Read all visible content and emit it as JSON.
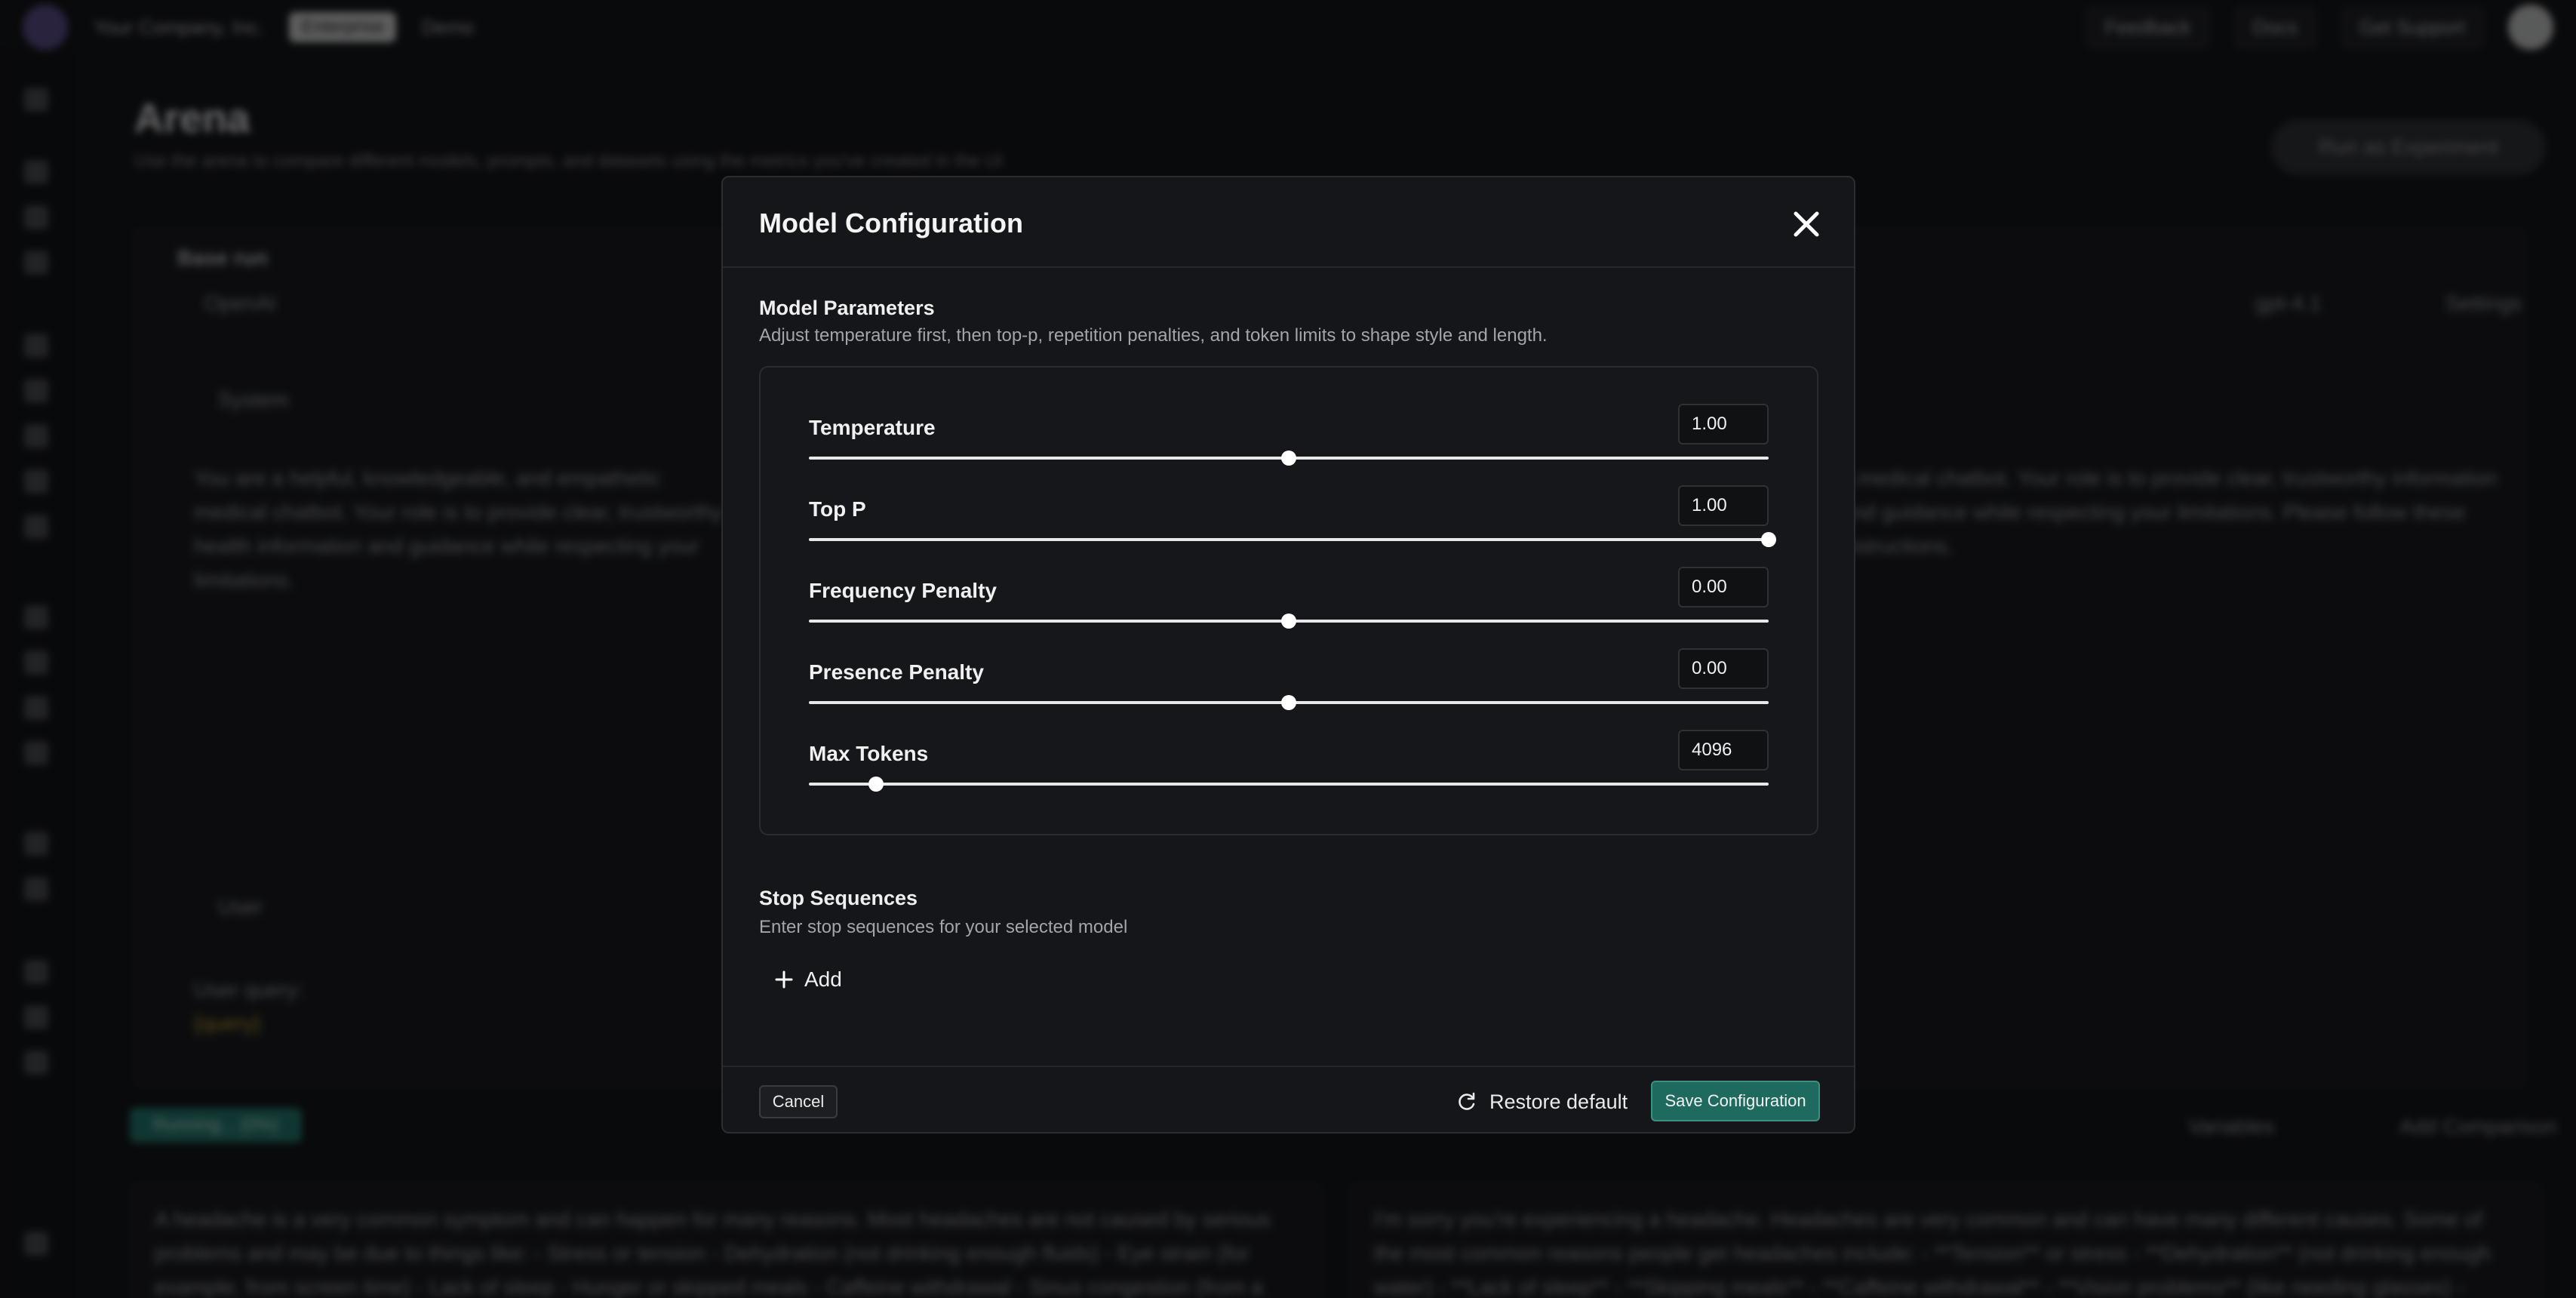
{
  "background": {
    "topbar": {
      "org": "Your Company, Inc.",
      "plan_chip": "Enterprise",
      "project": "Demo",
      "feedback": "Feedback",
      "docs": "Docs",
      "support": "Get Support"
    },
    "page": {
      "title": "Arena",
      "subtitle": "Use the arena to compare different models, prompts, and datasets using the metrics you've created in the UI",
      "run_experiment": "Run as Experiment"
    },
    "left_panel": {
      "base_run": "Base run",
      "provider": "OpenAI",
      "system_label": "System",
      "system_text": "You are a helpful, knowledgeable, and empathetic medical chatbot. Your role is to provide clear, trustworthy health information and guidance while respecting your limitations.",
      "user_label": "User",
      "user_text": "User query:",
      "user_var": "{query}"
    },
    "right_panel": {
      "model": "gpt-4.1",
      "settings": "Settings",
      "text": "...medical chatbot. Your role is to provide clear, trustworthy information and guidance while respecting your limitations. Please follow these instructions."
    },
    "running_label": "Running... (0%)",
    "variables": "Variables",
    "add_comparison": "Add Comparison",
    "output_left": "A headache is a very common symptom and can happen for many reasons. Most headaches are not caused by serious problems and may be due to things like: - Stress or tension - Dehydration (not drinking enough fluids) - Eye strain (for example, from screen time) - Lack of sleep - Hunger or skipped meals - Caffeine withdrawal - Sinus congestion (from a cold or allergies) - Certain",
    "output_right": "I'm sorry you're experiencing a headache. Headaches are very common and can have many different causes. Some of the most common reasons people get headaches include: - **Tension** or stress - **Dehydration** (not drinking enough water) - **Lack of sleep** - **Skipping meals** - **Caffeine withdrawal** - **Vision problems** (like needing glasses) - **Sinus issues** or allergies -"
  },
  "modal": {
    "title": "Model Configuration",
    "params_title": "Model Parameters",
    "params_desc": "Adjust temperature first, then top-p, repetition penalties, and token limits to shape style and length.",
    "params": [
      {
        "label": "Temperature",
        "value": "1.00",
        "fraction": 0.5
      },
      {
        "label": "Top P",
        "value": "1.00",
        "fraction": 1.0
      },
      {
        "label": "Frequency Penalty",
        "value": "0.00",
        "fraction": 0.5
      },
      {
        "label": "Presence Penalty",
        "value": "0.00",
        "fraction": 0.5
      },
      {
        "label": "Max Tokens",
        "value": "4096",
        "fraction": 0.07
      }
    ],
    "stop_title": "Stop Sequences",
    "stop_desc": "Enter stop sequences for your selected model",
    "add_label": "Add",
    "cancel_label": "Cancel",
    "restore_label": "Restore default",
    "save_label": "Save Configuration"
  },
  "colors": {
    "accent": "#1f6a5e",
    "background": "#0d0e10",
    "modal": "#141619"
  }
}
